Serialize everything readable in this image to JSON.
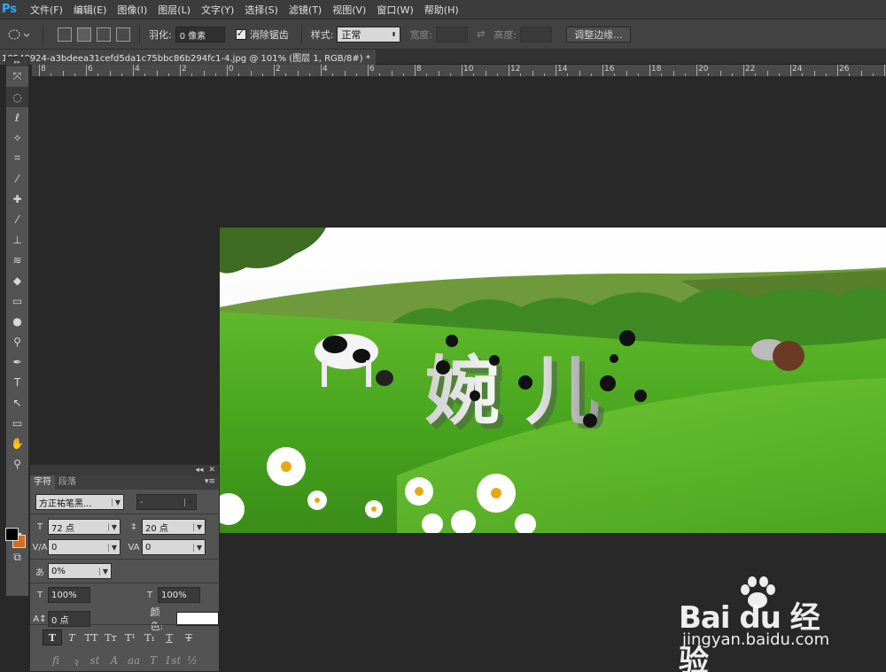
{
  "app": {
    "logo": "Ps",
    "menu": [
      "文件(F)",
      "编辑(E)",
      "图像(I)",
      "图层(L)",
      "文字(Y)",
      "选择(S)",
      "滤镜(T)",
      "视图(V)",
      "窗口(W)",
      "帮助(H)"
    ]
  },
  "options": {
    "feather_label": "羽化:",
    "feather_value": "0 像素",
    "antialias_label": "消除锯齿",
    "style_label": "样式:",
    "style_value": "正常",
    "width_label": "宽度:",
    "height_label": "高度:",
    "refine_edge_label": "调整边缘..."
  },
  "document": {
    "tab_title": "18548924-a3bdeea31cefd5da1c75bbc86b294fc1-4.jpg @ 101% (图层 1, RGB/8#) *",
    "close": "×"
  },
  "ruler": {
    "labels": [
      "8",
      "6",
      "4",
      "2",
      "0",
      "2",
      "4",
      "6",
      "8",
      "10",
      "12",
      "14",
      "16",
      "18",
      "20",
      "22",
      "24",
      "26",
      "28"
    ]
  },
  "canvas": {
    "text": "婉 儿"
  },
  "char_panel": {
    "tab_character": "字符",
    "tab_paragraph": "段落",
    "font_family": "方正祐笔黑...",
    "font_style": "-",
    "font_size": "72 点",
    "leading": "20 点",
    "kerning": "0",
    "tracking": "0",
    "scale_label_t": "T",
    "tsume": "0%",
    "vertical_scale": "100%",
    "horizontal_scale": "100%",
    "baseline_shift": "0 点",
    "color_label": "颜色:",
    "text_color": "#ffffff",
    "style_buttons": [
      "T",
      "T",
      "TT",
      "Tт",
      "T¹",
      "T₁",
      "T",
      "T"
    ],
    "opentype_buttons": [
      "fi",
      "ꝛ",
      "st",
      "A",
      "aa",
      "T",
      "1st",
      "½"
    ]
  },
  "watermark": {
    "brand": "Bai du 经验",
    "url": "jingyan.baidu.com"
  },
  "colors": {
    "foreground": "#000000",
    "background": "#d76c1e"
  }
}
